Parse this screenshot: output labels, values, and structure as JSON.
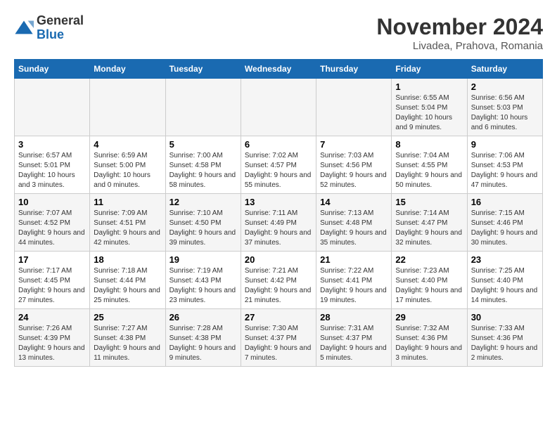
{
  "logo": {
    "general": "General",
    "blue": "Blue"
  },
  "header": {
    "title": "November 2024",
    "subtitle": "Livadea, Prahova, Romania"
  },
  "columns": [
    "Sunday",
    "Monday",
    "Tuesday",
    "Wednesday",
    "Thursday",
    "Friday",
    "Saturday"
  ],
  "weeks": [
    [
      {
        "day": "",
        "info": ""
      },
      {
        "day": "",
        "info": ""
      },
      {
        "day": "",
        "info": ""
      },
      {
        "day": "",
        "info": ""
      },
      {
        "day": "",
        "info": ""
      },
      {
        "day": "1",
        "info": "Sunrise: 6:55 AM\nSunset: 5:04 PM\nDaylight: 10 hours and 9 minutes."
      },
      {
        "day": "2",
        "info": "Sunrise: 6:56 AM\nSunset: 5:03 PM\nDaylight: 10 hours and 6 minutes."
      }
    ],
    [
      {
        "day": "3",
        "info": "Sunrise: 6:57 AM\nSunset: 5:01 PM\nDaylight: 10 hours and 3 minutes."
      },
      {
        "day": "4",
        "info": "Sunrise: 6:59 AM\nSunset: 5:00 PM\nDaylight: 10 hours and 0 minutes."
      },
      {
        "day": "5",
        "info": "Sunrise: 7:00 AM\nSunset: 4:58 PM\nDaylight: 9 hours and 58 minutes."
      },
      {
        "day": "6",
        "info": "Sunrise: 7:02 AM\nSunset: 4:57 PM\nDaylight: 9 hours and 55 minutes."
      },
      {
        "day": "7",
        "info": "Sunrise: 7:03 AM\nSunset: 4:56 PM\nDaylight: 9 hours and 52 minutes."
      },
      {
        "day": "8",
        "info": "Sunrise: 7:04 AM\nSunset: 4:55 PM\nDaylight: 9 hours and 50 minutes."
      },
      {
        "day": "9",
        "info": "Sunrise: 7:06 AM\nSunset: 4:53 PM\nDaylight: 9 hours and 47 minutes."
      }
    ],
    [
      {
        "day": "10",
        "info": "Sunrise: 7:07 AM\nSunset: 4:52 PM\nDaylight: 9 hours and 44 minutes."
      },
      {
        "day": "11",
        "info": "Sunrise: 7:09 AM\nSunset: 4:51 PM\nDaylight: 9 hours and 42 minutes."
      },
      {
        "day": "12",
        "info": "Sunrise: 7:10 AM\nSunset: 4:50 PM\nDaylight: 9 hours and 39 minutes."
      },
      {
        "day": "13",
        "info": "Sunrise: 7:11 AM\nSunset: 4:49 PM\nDaylight: 9 hours and 37 minutes."
      },
      {
        "day": "14",
        "info": "Sunrise: 7:13 AM\nSunset: 4:48 PM\nDaylight: 9 hours and 35 minutes."
      },
      {
        "day": "15",
        "info": "Sunrise: 7:14 AM\nSunset: 4:47 PM\nDaylight: 9 hours and 32 minutes."
      },
      {
        "day": "16",
        "info": "Sunrise: 7:15 AM\nSunset: 4:46 PM\nDaylight: 9 hours and 30 minutes."
      }
    ],
    [
      {
        "day": "17",
        "info": "Sunrise: 7:17 AM\nSunset: 4:45 PM\nDaylight: 9 hours and 27 minutes."
      },
      {
        "day": "18",
        "info": "Sunrise: 7:18 AM\nSunset: 4:44 PM\nDaylight: 9 hours and 25 minutes."
      },
      {
        "day": "19",
        "info": "Sunrise: 7:19 AM\nSunset: 4:43 PM\nDaylight: 9 hours and 23 minutes."
      },
      {
        "day": "20",
        "info": "Sunrise: 7:21 AM\nSunset: 4:42 PM\nDaylight: 9 hours and 21 minutes."
      },
      {
        "day": "21",
        "info": "Sunrise: 7:22 AM\nSunset: 4:41 PM\nDaylight: 9 hours and 19 minutes."
      },
      {
        "day": "22",
        "info": "Sunrise: 7:23 AM\nSunset: 4:40 PM\nDaylight: 9 hours and 17 minutes."
      },
      {
        "day": "23",
        "info": "Sunrise: 7:25 AM\nSunset: 4:40 PM\nDaylight: 9 hours and 14 minutes."
      }
    ],
    [
      {
        "day": "24",
        "info": "Sunrise: 7:26 AM\nSunset: 4:39 PM\nDaylight: 9 hours and 13 minutes."
      },
      {
        "day": "25",
        "info": "Sunrise: 7:27 AM\nSunset: 4:38 PM\nDaylight: 9 hours and 11 minutes."
      },
      {
        "day": "26",
        "info": "Sunrise: 7:28 AM\nSunset: 4:38 PM\nDaylight: 9 hours and 9 minutes."
      },
      {
        "day": "27",
        "info": "Sunrise: 7:30 AM\nSunset: 4:37 PM\nDaylight: 9 hours and 7 minutes."
      },
      {
        "day": "28",
        "info": "Sunrise: 7:31 AM\nSunset: 4:37 PM\nDaylight: 9 hours and 5 minutes."
      },
      {
        "day": "29",
        "info": "Sunrise: 7:32 AM\nSunset: 4:36 PM\nDaylight: 9 hours and 3 minutes."
      },
      {
        "day": "30",
        "info": "Sunrise: 7:33 AM\nSunset: 4:36 PM\nDaylight: 9 hours and 2 minutes."
      }
    ]
  ]
}
